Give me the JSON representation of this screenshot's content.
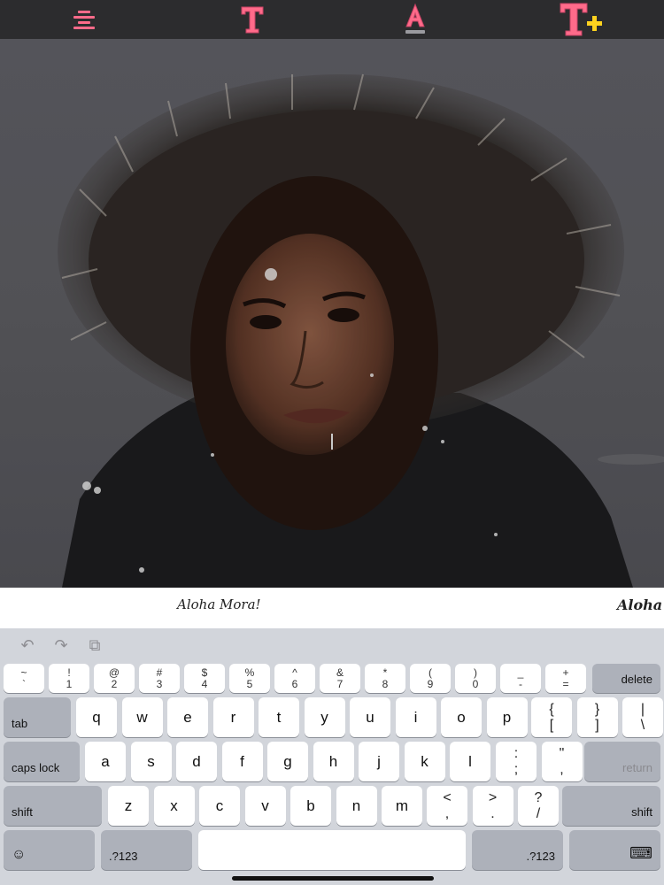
{
  "toolbar": {
    "icons": [
      "align-center-icon",
      "text-style-icon",
      "text-color-icon",
      "add-text-icon"
    ],
    "accent": "#ff6b8a",
    "plus_color": "#ffd21f"
  },
  "editor": {
    "overlay_text": ""
  },
  "fonts_strip": {
    "samples": [
      "Aloha Mora!",
      "Aloha M"
    ]
  },
  "keyboard": {
    "assist": {
      "undo": "↶",
      "redo": "↷",
      "paste": "⧉"
    },
    "row1": [
      {
        "top": "~",
        "bottom": "`"
      },
      {
        "top": "!",
        "bottom": "1"
      },
      {
        "top": "@",
        "bottom": "2"
      },
      {
        "top": "#",
        "bottom": "3"
      },
      {
        "top": "$",
        "bottom": "4"
      },
      {
        "top": "%",
        "bottom": "5"
      },
      {
        "top": "^",
        "bottom": "6"
      },
      {
        "top": "&",
        "bottom": "7"
      },
      {
        "top": "*",
        "bottom": "8"
      },
      {
        "top": "(",
        "bottom": "9"
      },
      {
        "top": ")",
        "bottom": "0"
      },
      {
        "top": "_",
        "bottom": "-"
      },
      {
        "top": "+",
        "bottom": "="
      }
    ],
    "delete": "delete",
    "tab": "tab",
    "row2": [
      "q",
      "w",
      "e",
      "r",
      "t",
      "y",
      "u",
      "i",
      "o",
      "p"
    ],
    "row2_extra": [
      {
        "top": "{",
        "bottom": "["
      },
      {
        "top": "}",
        "bottom": "]"
      },
      {
        "top": "|",
        "bottom": "\\"
      }
    ],
    "caps_lock": "caps lock",
    "row3": [
      "a",
      "s",
      "d",
      "f",
      "g",
      "h",
      "j",
      "k",
      "l"
    ],
    "row3_extra": [
      {
        "top": ":",
        "bottom": ";"
      },
      {
        "top": "\"",
        "bottom": ","
      }
    ],
    "return": "return",
    "shift": "shift",
    "row4": [
      "z",
      "x",
      "c",
      "v",
      "b",
      "n",
      "m"
    ],
    "row4_extra": [
      {
        "top": "<",
        "bottom": ","
      },
      {
        "top": ">",
        "bottom": "."
      },
      {
        "top": "?",
        "bottom": "/"
      }
    ],
    "emoji": "☺",
    "numbers": ".?123",
    "space": "",
    "dismiss": "⌨"
  }
}
